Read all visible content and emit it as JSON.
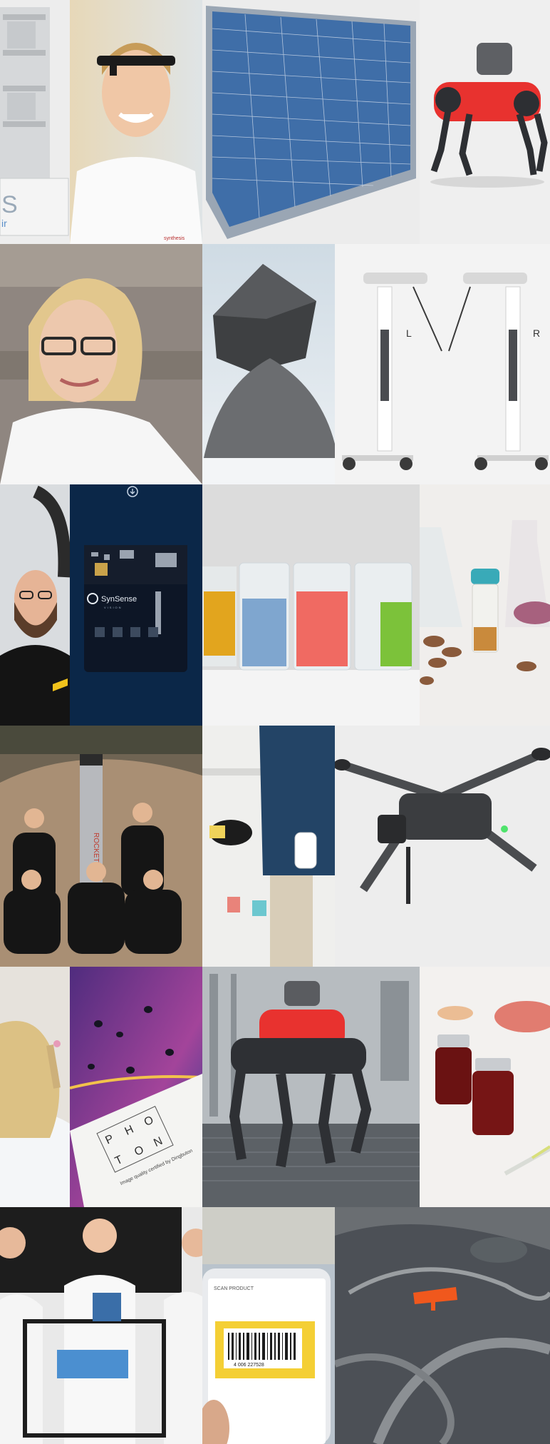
{
  "tiles": {
    "machine": {
      "label_fragment": "S",
      "label_fragment2": "ir"
    },
    "portrait_boy": {
      "shirt_logo": "synthesis"
    },
    "solar_panel": {},
    "robot_dog_top": {},
    "portrait_woman": {},
    "foam_cube": {},
    "surgical_robot": {
      "arm_left_label": "L",
      "arm_right_label": "R"
    },
    "bearded_man": {},
    "chip_board": {
      "brand": "SynSense",
      "sub_brand": "VISION"
    },
    "beakers": {},
    "lab_nuts": {},
    "rocket_team": {
      "rocket_text": "ROCKET"
    },
    "glove_blocks": {},
    "drone": {},
    "lab_woman_back": {},
    "photon_card": {
      "letters": [
        "P",
        "H",
        "O",
        "T",
        "O",
        "N"
      ],
      "caption": "Image quality certified by Dingbuton"
    },
    "robot_dog_factory": {},
    "vials": {},
    "lab_team": {},
    "phone_scan": {
      "header": "SCAN PRODUCT",
      "barcode_digits": "4 006 227528"
    },
    "aerial_drone": {}
  },
  "colors": {
    "navy": "#0b2748",
    "robot_red": "#e8322f",
    "panel_blue": "#3f6ea8"
  }
}
